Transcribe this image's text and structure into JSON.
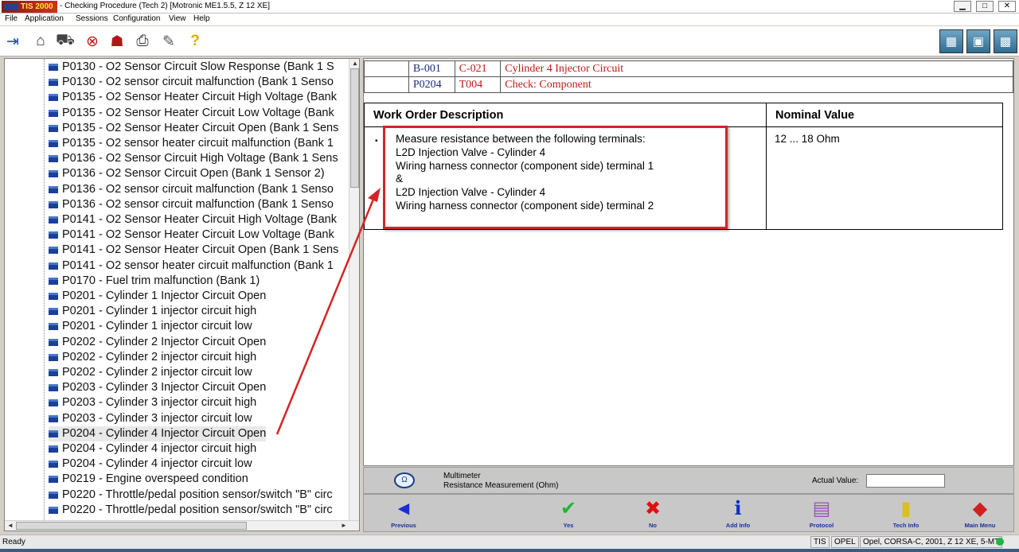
{
  "window": {
    "brand": "TIS 2000",
    "title": "- Checking Procedure (Tech 2) [Motronic ME1.5.5, Z 12 XE]",
    "min": "▁",
    "max": "□",
    "close": "✕"
  },
  "menu": [
    "File",
    "Application",
    "Sessions",
    "Configuration",
    "View",
    "Help"
  ],
  "toolbar": {
    "left_icons": [
      "exit-icon",
      "home-icon",
      "vehicle-icon",
      "stop-icon",
      "person-icon",
      "print-icon",
      "notepad-icon",
      "help-icon"
    ],
    "right_icons": [
      "tech2-icon",
      "diagnosis-icon",
      "flash-icon"
    ]
  },
  "tree": {
    "items": [
      "P0130 - O2 Sensor Circuit Slow Response (Bank 1 S",
      "P0130 - O2 sensor circuit malfunction (Bank 1 Senso",
      "P0135 - O2 Sensor Heater Circuit High Voltage (Bank",
      "P0135 - O2 Sensor Heater Circuit Low Voltage (Bank",
      "P0135 - O2 Sensor Heater Circuit Open (Bank 1 Sens",
      "P0135 - O2 sensor heater circuit malfunction (Bank 1",
      "P0136 - O2 Sensor Circuit High Voltage (Bank 1 Sens",
      "P0136 - O2 Sensor Circuit Open (Bank 1 Sensor 2)",
      "P0136 - O2 sensor circuit malfunction (Bank 1 Senso",
      "P0136 - O2 sensor circuit malfunction (Bank 1 Senso",
      "P0141 - O2 Sensor Heater Circuit High Voltage (Bank",
      "P0141 - O2 Sensor Heater Circuit Low Voltage (Bank",
      "P0141 - O2 Sensor Heater Circuit Open (Bank 1 Sens",
      "P0141 - O2 sensor heater circuit malfunction (Bank 1",
      "P0170 - Fuel trim malfunction (Bank 1)",
      "P0201 - Cylinder 1 Injector Circuit Open",
      "P0201 - Cylinder 1 injector circuit high",
      "P0201 - Cylinder 1 injector circuit low",
      "P0202 - Cylinder 2 Injector Circuit Open",
      "P0202 - Cylinder 2 injector circuit high",
      "P0202 - Cylinder 2 injector circuit low",
      "P0203 - Cylinder 3 Injector Circuit Open",
      "P0203 - Cylinder 3 injector circuit high",
      "P0203 - Cylinder 3 injector circuit low",
      "P0204 - Cylinder 4 Injector Circuit Open",
      "P0204 - Cylinder 4 injector circuit high",
      "P0204 - Cylinder 4 injector circuit low",
      "P0219 - Engine overspeed condition",
      "P0220 - Throttle/pedal position sensor/switch \"B\" circ",
      "P0220 - Throttle/pedal position sensor/switch \"B\" circ"
    ],
    "selected_index": 24
  },
  "codes": [
    [
      "",
      "B-001",
      "C-021",
      "Cylinder 4 Injector Circuit"
    ],
    [
      "",
      "P0204",
      "T004",
      "Check: Component"
    ]
  ],
  "work_order": {
    "desc_header": "Work Order Description",
    "nominal_header": "Nominal Value",
    "bullet": "•",
    "lines": [
      "Measure resistance between the following terminals:",
      "L2D Injection Valve - Cylinder 4",
      "Wiring harness connector (component side) terminal 1",
      "&",
      "L2D Injection Valve - Cylinder 4",
      "Wiring harness connector (component side) terminal 2"
    ],
    "nominal": "12 ... 18 Ohm"
  },
  "measurement": {
    "title": "Multimeter",
    "subtitle": "Resistance Measurement (Ohm)",
    "actual_label": "Actual Value:",
    "actual_value": ""
  },
  "nav": [
    {
      "label": "Previous",
      "icon": "◄",
      "color": "#1a2fd0",
      "name": "previous"
    },
    {
      "label": "Yes",
      "icon": "✔",
      "color": "#18b830",
      "name": "yes"
    },
    {
      "label": "No",
      "icon": "✖",
      "color": "#e01010",
      "name": "no"
    },
    {
      "label": "Add Info",
      "icon": "ℹ",
      "color": "#1030c8",
      "name": "add-info"
    },
    {
      "label": "Protocol",
      "icon": "▤",
      "color": "#a050c0",
      "name": "protocol"
    },
    {
      "label": "Tech Info",
      "icon": "▮",
      "color": "#d8c020",
      "name": "tech-info"
    },
    {
      "label": "Main Menu",
      "icon": "◆",
      "color": "#d02020",
      "name": "main-menu"
    }
  ],
  "status": {
    "text": "Ready",
    "cells": [
      "TIS",
      "OPEL",
      "Opel, CORSA-C, 2001, Z 12 XE, 5-MT"
    ]
  },
  "colors": {
    "annotation": "#d42525",
    "code_red": "#c01818",
    "code_blue": "#1a2a80"
  }
}
